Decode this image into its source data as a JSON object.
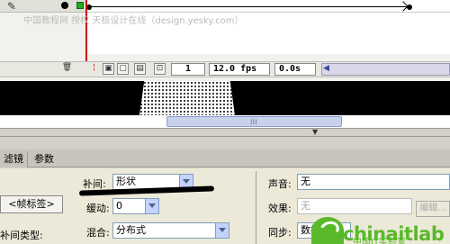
{
  "watermark": "中国教程网 授权 天极设计在线（design.yesky.com）",
  "timeline": {
    "frame_number": "1",
    "fps": "12.0 fps",
    "elapsed": "0.0s",
    "icons": [
      "trash-icon",
      "center-frame-icon",
      "onion-skin-icon",
      "onion-outline-icon",
      "edit-multiple-frames-icon",
      "onion-markers-icon"
    ]
  },
  "properties": {
    "tabs": [
      "滤镜",
      "参数"
    ],
    "frame_label_placeholder": "<帧标签>",
    "tween_type_label": "补间类型:",
    "tween_label": "补间:",
    "tween_value": "形状",
    "ease_label": "缓动:",
    "ease_value": "0",
    "blend_label": "混合:",
    "blend_value": "分布式",
    "sound_label": "声音:",
    "sound_value": "无",
    "effect_label": "效果:",
    "effect_value": "无",
    "edit_label": "编辑...",
    "sync_label": "同步:",
    "sync_value": "数据流"
  },
  "logo": {
    "text": "chinaitlab",
    "subtitle": "中国IT实验室"
  },
  "colors": {
    "accent_green": "#5ab92a",
    "playhead_red": "#cc0000",
    "panel_bg": "#ece9d8"
  }
}
